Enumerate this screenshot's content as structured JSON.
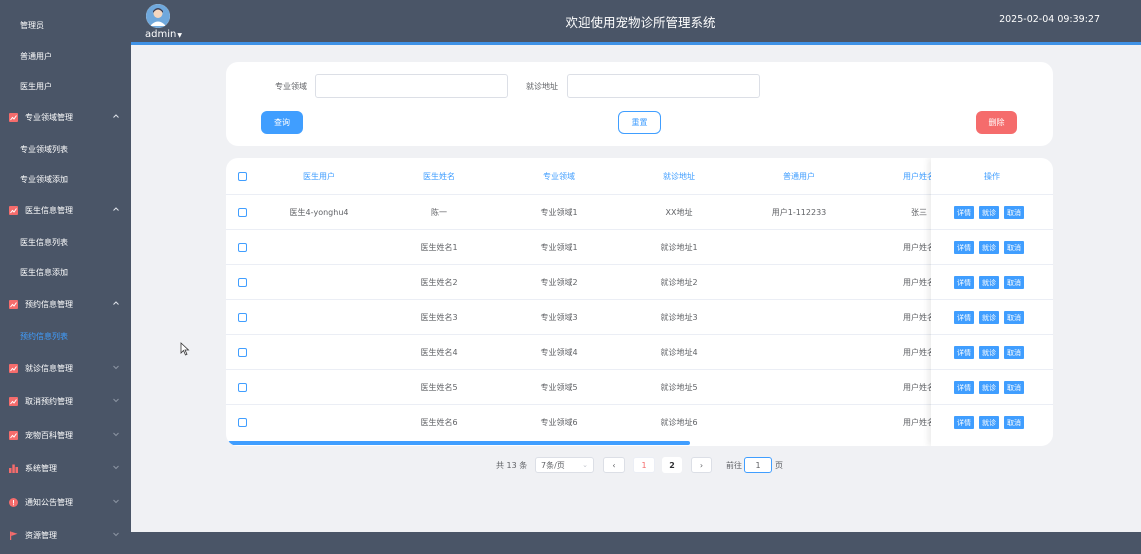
{
  "header": {
    "title": "欢迎使用宠物诊所管理系统",
    "datetime": "2025-02-04 09:39:27",
    "user": "admin"
  },
  "sidebar": {
    "top_items": [
      "管理员",
      "普通用户",
      "医生用户"
    ],
    "groups": [
      {
        "label": "专业领域管理",
        "icon": "chart-icon",
        "expanded": true,
        "children": [
          "专业领域列表",
          "专业领域添加"
        ]
      },
      {
        "label": "医生信息管理",
        "icon": "chart-icon",
        "expanded": true,
        "children": [
          "医生信息列表",
          "医生信息添加"
        ]
      },
      {
        "label": "预约信息管理",
        "icon": "chart-icon",
        "expanded": true,
        "children": [
          "预约信息列表"
        ]
      },
      {
        "label": "就诊信息管理",
        "icon": "chart-icon",
        "expanded": false,
        "children": []
      },
      {
        "label": "取消预约管理",
        "icon": "chart-icon",
        "expanded": false,
        "children": []
      },
      {
        "label": "宠物百科管理",
        "icon": "chart-icon",
        "expanded": false,
        "children": []
      },
      {
        "label": "系统管理",
        "icon": "bar-chart-icon",
        "expanded": false,
        "children": []
      },
      {
        "label": "通知公告管理",
        "icon": "info-icon",
        "expanded": false,
        "children": []
      },
      {
        "label": "资源管理",
        "icon": "flag-icon",
        "expanded": false,
        "children": []
      }
    ],
    "active": "预约信息列表"
  },
  "search": {
    "field1_label": "专业领域",
    "field1_value": "",
    "field2_label": "就诊地址",
    "field2_value": "",
    "query_label": "查询",
    "reset_label": "重置",
    "delete_label": "删除"
  },
  "table": {
    "columns": [
      "医生用户",
      "医生姓名",
      "专业领域",
      "就诊地址",
      "普通用户",
      "用户姓名",
      "操作"
    ],
    "rows": [
      {
        "doctor_user": "医生4-yonghu4",
        "doctor_name": "陈一",
        "field": "专业领域1",
        "address": "XX地址",
        "user": "用户1-112233",
        "user_name": "张三"
      },
      {
        "doctor_user": "",
        "doctor_name": "医生姓名1",
        "field": "专业领域1",
        "address": "就诊地址1",
        "user": "",
        "user_name": "用户姓名"
      },
      {
        "doctor_user": "",
        "doctor_name": "医生姓名2",
        "field": "专业领域2",
        "address": "就诊地址2",
        "user": "",
        "user_name": "用户姓名"
      },
      {
        "doctor_user": "",
        "doctor_name": "医生姓名3",
        "field": "专业领域3",
        "address": "就诊地址3",
        "user": "",
        "user_name": "用户姓名"
      },
      {
        "doctor_user": "",
        "doctor_name": "医生姓名4",
        "field": "专业领域4",
        "address": "就诊地址4",
        "user": "",
        "user_name": "用户姓名"
      },
      {
        "doctor_user": "",
        "doctor_name": "医生姓名5",
        "field": "专业领域5",
        "address": "就诊地址5",
        "user": "",
        "user_name": "用户姓名"
      },
      {
        "doctor_user": "",
        "doctor_name": "医生姓名6",
        "field": "专业领域6",
        "address": "就诊地址6",
        "user": "",
        "user_name": "用户姓名"
      }
    ],
    "op_labels": [
      "详情",
      "就诊",
      "取消"
    ]
  },
  "pagination": {
    "total_text": "共 13 条",
    "page_size": "7条/页",
    "pages": [
      "1",
      "2"
    ],
    "current": "1",
    "goto_prefix": "前往",
    "goto_value": "1",
    "goto_suffix": "页"
  },
  "colors": {
    "sidebar_bg": "#4a5567",
    "accent": "#409eff",
    "danger": "#f56c6c",
    "icon_red": "#f56c6c"
  }
}
